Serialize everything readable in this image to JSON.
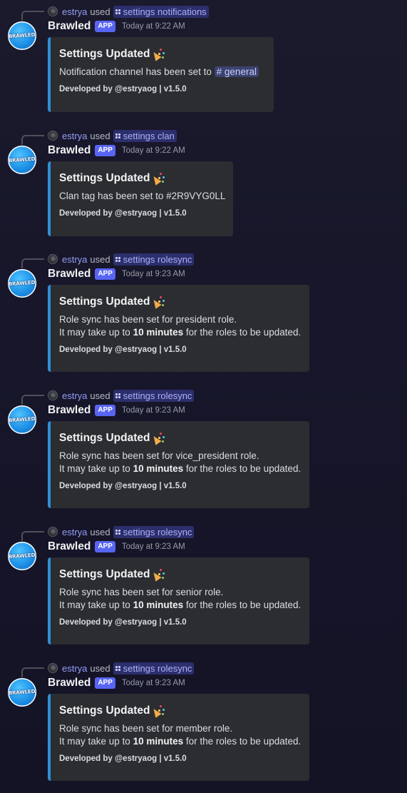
{
  "messages": [
    {
      "reply_user": "estrya",
      "reply_used": "used",
      "command": "settings notifications",
      "author": "Brawled",
      "badge": "APP",
      "time": "Today at 9:22 AM",
      "avatar_text": "BRAWLED",
      "embed_title": "Settings Updated",
      "desc_line1_prefix": "Notification channel has been set to",
      "channel_mention": "# general",
      "footer": "Developed by @estryaog | v1.5.0"
    },
    {
      "reply_user": "estrya",
      "reply_used": "used",
      "command": "settings clan",
      "author": "Brawled",
      "badge": "APP",
      "time": "Today at 9:22 AM",
      "avatar_text": "BRAWLED",
      "embed_title": "Settings Updated",
      "desc_line1": "Clan tag has been set to #2R9VYG0LL",
      "footer": "Developed by @estryaog | v1.5.0"
    },
    {
      "reply_user": "estrya",
      "reply_used": "used",
      "command": "settings rolesync",
      "author": "Brawled",
      "badge": "APP",
      "time": "Today at 9:23 AM",
      "avatar_text": "BRAWLED",
      "embed_title": "Settings Updated",
      "desc_line1": "Role sync has been set for president role.",
      "desc_line2_prefix": "It may take up to",
      "desc_line2_bold": "10 minutes",
      "desc_line2_suffix": "for the roles to be updated.",
      "footer": "Developed by @estryaog | v1.5.0"
    },
    {
      "reply_user": "estrya",
      "reply_used": "used",
      "command": "settings rolesync",
      "author": "Brawled",
      "badge": "APP",
      "time": "Today at 9:23 AM",
      "avatar_text": "BRAWLED",
      "embed_title": "Settings Updated",
      "desc_line1": "Role sync has been set for vice_president role.",
      "desc_line2_prefix": "It may take up to",
      "desc_line2_bold": "10 minutes",
      "desc_line2_suffix": "for the roles to be updated.",
      "footer": "Developed by @estryaog | v1.5.0"
    },
    {
      "reply_user": "estrya",
      "reply_used": "used",
      "command": "settings rolesync",
      "author": "Brawled",
      "badge": "APP",
      "time": "Today at 9:23 AM",
      "avatar_text": "BRAWLED",
      "embed_title": "Settings Updated",
      "desc_line1": "Role sync has been set for senior role.",
      "desc_line2_prefix": "It may take up to",
      "desc_line2_bold": "10 minutes",
      "desc_line2_suffix": "for the roles to be updated.",
      "footer": "Developed by @estryaog | v1.5.0"
    },
    {
      "reply_user": "estrya",
      "reply_used": "used",
      "command": "settings rolesync",
      "author": "Brawled",
      "badge": "APP",
      "time": "Today at 9:23 AM",
      "avatar_text": "BRAWLED",
      "embed_title": "Settings Updated",
      "desc_line1": "Role sync has been set for member role.",
      "desc_line2_prefix": "It may take up to",
      "desc_line2_bold": "10 minutes",
      "desc_line2_suffix": "for the roles to be updated.",
      "footer": "Developed by @estryaog | v1.5.0"
    }
  ],
  "theme": {
    "embed_accent": "#2f8fd6",
    "app_badge": "#5865f2",
    "reply_user_color": "#949cf7",
    "icons": [
      "command-icon",
      "party-popper-icon",
      "bot-avatar"
    ]
  }
}
